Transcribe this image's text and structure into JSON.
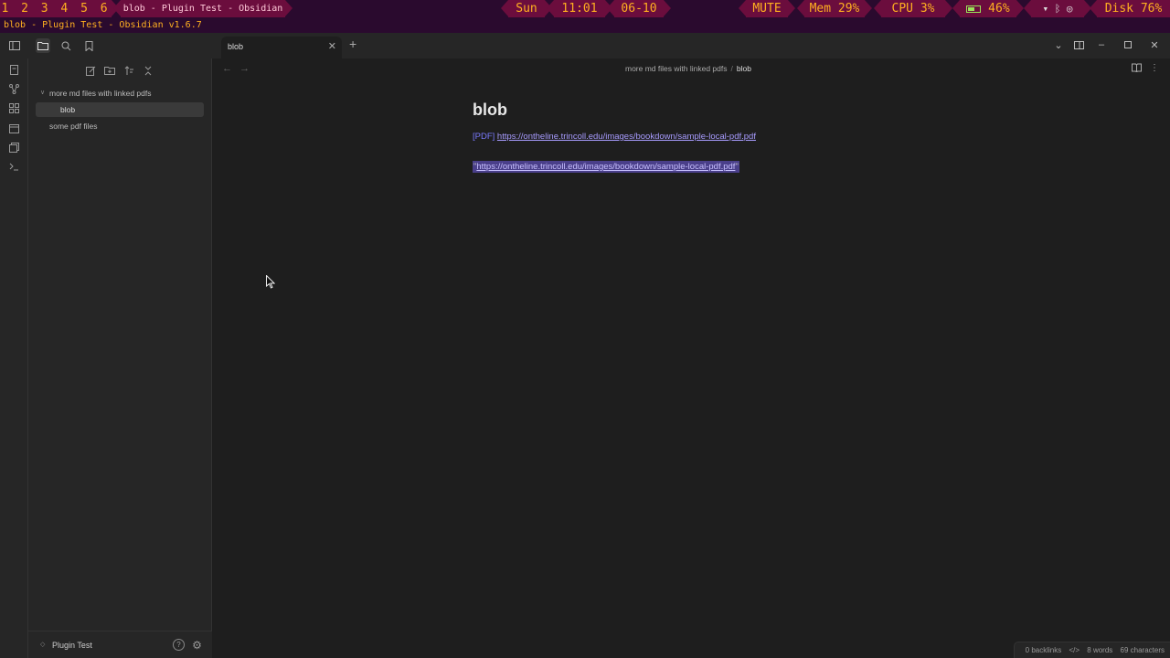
{
  "sysbar": {
    "workspaces": "1 2 3 4 5 6",
    "window_title": "blob - Plugin Test - Obsidian v1.6.7",
    "day": "Sun",
    "time": "11:01",
    "date": "06-10",
    "volume": "MUTE",
    "mem": "Mem 29%",
    "cpu": "CPU  3%",
    "battery": "46%",
    "disk": "Disk 76%"
  },
  "wm_title": "blob - Plugin Test - Obsidian v1.6.7",
  "sidebar": {
    "folders": [
      {
        "label": "more md files with linked pdfs",
        "expanded": true,
        "children": [
          {
            "label": "blob",
            "selected": true
          }
        ]
      },
      {
        "label": "some pdf files",
        "expanded": false
      }
    ],
    "vault_name": "Plugin Test"
  },
  "tabs": [
    {
      "label": "blob"
    }
  ],
  "editor": {
    "breadcrumb": {
      "folder": "more md files with linked pdfs",
      "sep": "/",
      "file": "blob"
    },
    "title": "blob",
    "pdf_tag": "[PDF]",
    "link1": "https://ontheline.trincoll.edu/images/bookdown/sample-local-pdf.pdf",
    "link2": "https://ontheline.trincoll.edu/images/bookdown/sample-local-pdf.pdf",
    "quote_open": "\"",
    "quote_close": "\""
  },
  "status": {
    "backlinks": "0 backlinks",
    "words": "8 words",
    "characters": "69 characters"
  },
  "colors": {
    "sysbar_bg": "#2a0a2e",
    "segment_bg": "#6b0d3d",
    "segment_fg": "#ffb020",
    "link": "#a89cff",
    "selection": "#4a3f8a"
  }
}
